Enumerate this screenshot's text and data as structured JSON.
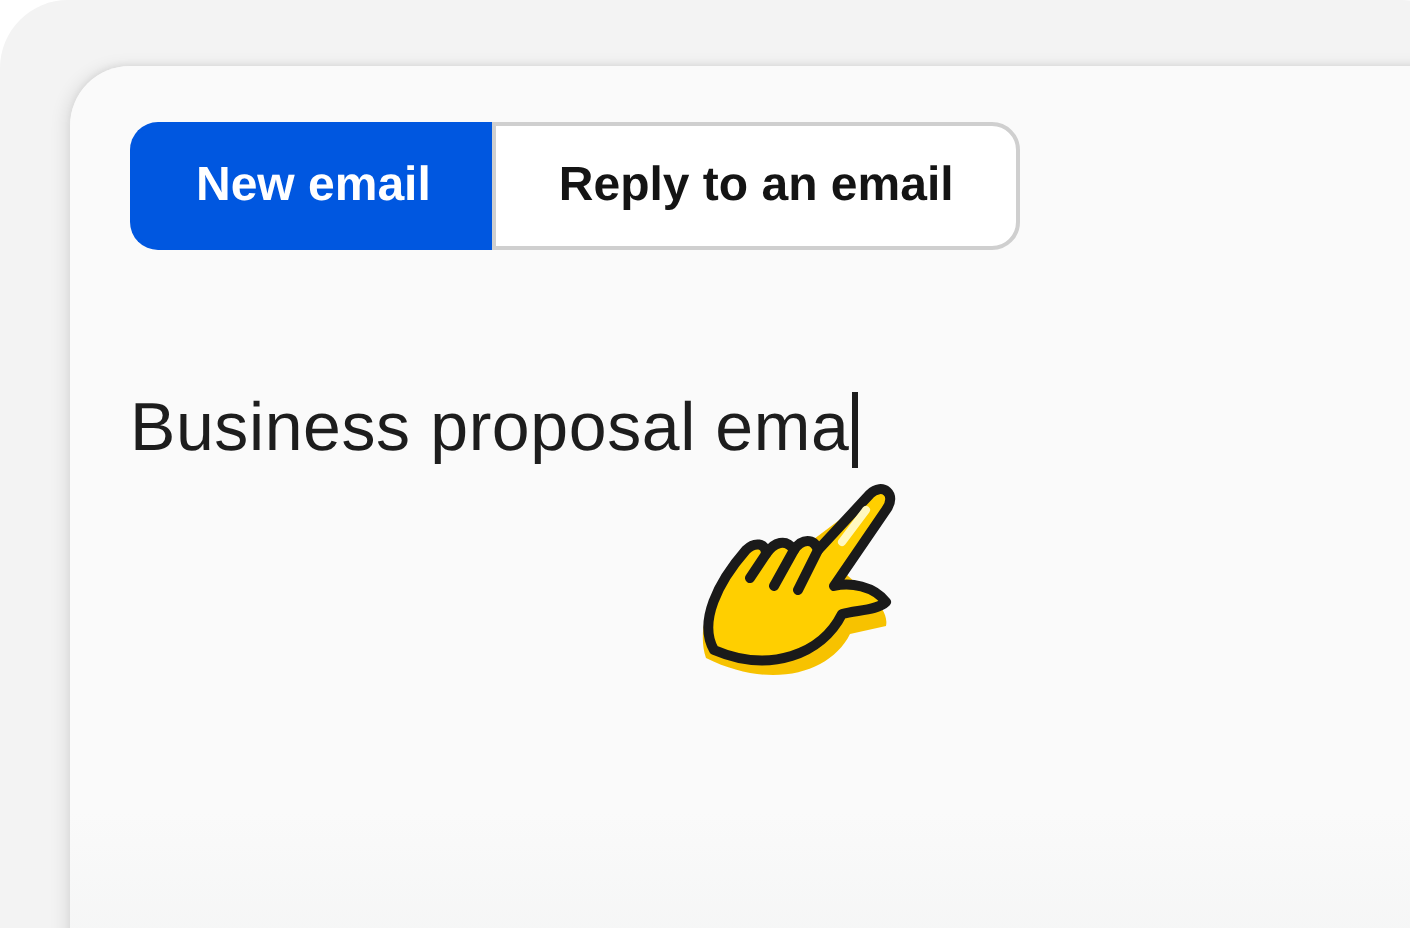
{
  "tabs": [
    {
      "label": "New email",
      "selected": true
    },
    {
      "label": "Reply to an email",
      "selected": false
    }
  ],
  "prompt_field": {
    "value": "Business proposal ema"
  }
}
